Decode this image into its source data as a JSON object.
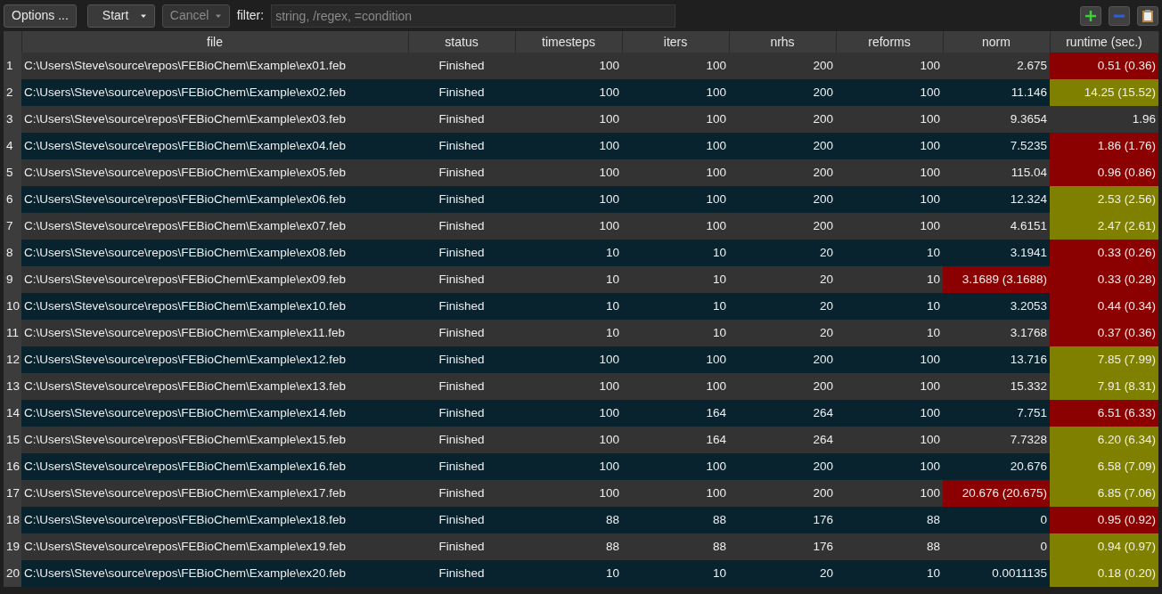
{
  "toolbar": {
    "options_button": "Options ...",
    "start_button": "Start",
    "cancel_button": {
      "label": "Cancel",
      "disabled": true
    },
    "filter_label": "filter:",
    "filter_placeholder": "string, /regex, =condition"
  },
  "table": {
    "columns": [
      "file",
      "status",
      "timesteps",
      "iters",
      "nrhs",
      "reforms",
      "norm",
      "runtime (sec.)"
    ],
    "rows": [
      {
        "number": "1",
        "cells": [
          {
            "text": "C:\\Users\\Steve\\source\\repos\\FEBioChem\\Example\\ex01.feb"
          },
          {
            "text": "Finished"
          },
          {
            "text": "100"
          },
          {
            "text": "100"
          },
          {
            "text": "200"
          },
          {
            "text": "100"
          },
          {
            "text": "2.675"
          },
          {
            "text": "0.51 (0.36)",
            "color": "#8b0000"
          }
        ]
      },
      {
        "number": "2",
        "cells": [
          {
            "text": "C:\\Users\\Steve\\source\\repos\\FEBioChem\\Example\\ex02.feb"
          },
          {
            "text": "Finished"
          },
          {
            "text": "100"
          },
          {
            "text": "100"
          },
          {
            "text": "200"
          },
          {
            "text": "100"
          },
          {
            "text": "11.146"
          },
          {
            "text": "14.25 (15.52)",
            "color": "#808000"
          }
        ]
      },
      {
        "number": "3",
        "cells": [
          {
            "text": "C:\\Users\\Steve\\source\\repos\\FEBioChem\\Example\\ex03.feb"
          },
          {
            "text": "Finished"
          },
          {
            "text": "100"
          },
          {
            "text": "100"
          },
          {
            "text": "200"
          },
          {
            "text": "100"
          },
          {
            "text": "9.3654"
          },
          {
            "text": "1.96"
          }
        ]
      },
      {
        "number": "4",
        "cells": [
          {
            "text": "C:\\Users\\Steve\\source\\repos\\FEBioChem\\Example\\ex04.feb"
          },
          {
            "text": "Finished"
          },
          {
            "text": "100"
          },
          {
            "text": "100"
          },
          {
            "text": "200"
          },
          {
            "text": "100"
          },
          {
            "text": "7.5235"
          },
          {
            "text": "1.86 (1.76)",
            "color": "#8b0000"
          }
        ]
      },
      {
        "number": "5",
        "cells": [
          {
            "text": "C:\\Users\\Steve\\source\\repos\\FEBioChem\\Example\\ex05.feb"
          },
          {
            "text": "Finished"
          },
          {
            "text": "100"
          },
          {
            "text": "100"
          },
          {
            "text": "200"
          },
          {
            "text": "100"
          },
          {
            "text": "115.04"
          },
          {
            "text": "0.96 (0.86)",
            "color": "#8b0000"
          }
        ]
      },
      {
        "number": "6",
        "cells": [
          {
            "text": "C:\\Users\\Steve\\source\\repos\\FEBioChem\\Example\\ex06.feb"
          },
          {
            "text": "Finished"
          },
          {
            "text": "100"
          },
          {
            "text": "100"
          },
          {
            "text": "200"
          },
          {
            "text": "100"
          },
          {
            "text": "12.324"
          },
          {
            "text": "2.53 (2.56)",
            "color": "#808000"
          }
        ]
      },
      {
        "number": "7",
        "cells": [
          {
            "text": "C:\\Users\\Steve\\source\\repos\\FEBioChem\\Example\\ex07.feb"
          },
          {
            "text": "Finished"
          },
          {
            "text": "100"
          },
          {
            "text": "100"
          },
          {
            "text": "200"
          },
          {
            "text": "100"
          },
          {
            "text": "4.6151"
          },
          {
            "text": "2.47 (2.61)",
            "color": "#808000"
          }
        ]
      },
      {
        "number": "8",
        "cells": [
          {
            "text": "C:\\Users\\Steve\\source\\repos\\FEBioChem\\Example\\ex08.feb"
          },
          {
            "text": "Finished"
          },
          {
            "text": "10"
          },
          {
            "text": "10"
          },
          {
            "text": "20"
          },
          {
            "text": "10"
          },
          {
            "text": "3.1941"
          },
          {
            "text": "0.33 (0.26)",
            "color": "#8b0000"
          }
        ]
      },
      {
        "number": "9",
        "cells": [
          {
            "text": "C:\\Users\\Steve\\source\\repos\\FEBioChem\\Example\\ex09.feb"
          },
          {
            "text": "Finished"
          },
          {
            "text": "10"
          },
          {
            "text": "10"
          },
          {
            "text": "20"
          },
          {
            "text": "10"
          },
          {
            "text": "3.1689 (3.1688)",
            "color": "#8b0000"
          },
          {
            "text": "0.33 (0.28)",
            "color": "#8b0000"
          }
        ]
      },
      {
        "number": "10",
        "cells": [
          {
            "text": "C:\\Users\\Steve\\source\\repos\\FEBioChem\\Example\\ex10.feb"
          },
          {
            "text": "Finished"
          },
          {
            "text": "10"
          },
          {
            "text": "10"
          },
          {
            "text": "20"
          },
          {
            "text": "10"
          },
          {
            "text": "3.2053"
          },
          {
            "text": "0.44 (0.34)",
            "color": "#8b0000"
          }
        ]
      },
      {
        "number": "11",
        "cells": [
          {
            "text": "C:\\Users\\Steve\\source\\repos\\FEBioChem\\Example\\ex11.feb"
          },
          {
            "text": "Finished"
          },
          {
            "text": "10"
          },
          {
            "text": "10"
          },
          {
            "text": "20"
          },
          {
            "text": "10"
          },
          {
            "text": "3.1768"
          },
          {
            "text": "0.37 (0.36)",
            "color": "#8b0000"
          }
        ]
      },
      {
        "number": "12",
        "cells": [
          {
            "text": "C:\\Users\\Steve\\source\\repos\\FEBioChem\\Example\\ex12.feb"
          },
          {
            "text": "Finished"
          },
          {
            "text": "100"
          },
          {
            "text": "100"
          },
          {
            "text": "200"
          },
          {
            "text": "100"
          },
          {
            "text": "13.716"
          },
          {
            "text": "7.85 (7.99)",
            "color": "#808000"
          }
        ]
      },
      {
        "number": "13",
        "cells": [
          {
            "text": "C:\\Users\\Steve\\source\\repos\\FEBioChem\\Example\\ex13.feb"
          },
          {
            "text": "Finished"
          },
          {
            "text": "100"
          },
          {
            "text": "100"
          },
          {
            "text": "200"
          },
          {
            "text": "100"
          },
          {
            "text": "15.332"
          },
          {
            "text": "7.91 (8.31)",
            "color": "#808000"
          }
        ]
      },
      {
        "number": "14",
        "cells": [
          {
            "text": "C:\\Users\\Steve\\source\\repos\\FEBioChem\\Example\\ex14.feb"
          },
          {
            "text": "Finished"
          },
          {
            "text": "100"
          },
          {
            "text": "164"
          },
          {
            "text": "264"
          },
          {
            "text": "100"
          },
          {
            "text": "7.751"
          },
          {
            "text": "6.51 (6.33)",
            "color": "#8b0000"
          }
        ]
      },
      {
        "number": "15",
        "cells": [
          {
            "text": "C:\\Users\\Steve\\source\\repos\\FEBioChem\\Example\\ex15.feb"
          },
          {
            "text": "Finished"
          },
          {
            "text": "100"
          },
          {
            "text": "164"
          },
          {
            "text": "264"
          },
          {
            "text": "100"
          },
          {
            "text": "7.7328"
          },
          {
            "text": "6.20 (6.34)",
            "color": "#808000"
          }
        ]
      },
      {
        "number": "16",
        "cells": [
          {
            "text": "C:\\Users\\Steve\\source\\repos\\FEBioChem\\Example\\ex16.feb"
          },
          {
            "text": "Finished"
          },
          {
            "text": "100"
          },
          {
            "text": "100"
          },
          {
            "text": "200"
          },
          {
            "text": "100"
          },
          {
            "text": "20.676"
          },
          {
            "text": "6.58 (7.09)",
            "color": "#808000"
          }
        ]
      },
      {
        "number": "17",
        "cells": [
          {
            "text": "C:\\Users\\Steve\\source\\repos\\FEBioChem\\Example\\ex17.feb"
          },
          {
            "text": "Finished"
          },
          {
            "text": "100"
          },
          {
            "text": "100"
          },
          {
            "text": "200"
          },
          {
            "text": "100"
          },
          {
            "text": "20.676 (20.675)",
            "color": "#8b0000"
          },
          {
            "text": "6.85 (7.06)",
            "color": "#808000"
          }
        ]
      },
      {
        "number": "18",
        "cells": [
          {
            "text": "C:\\Users\\Steve\\source\\repos\\FEBioChem\\Example\\ex18.feb"
          },
          {
            "text": "Finished"
          },
          {
            "text": "88"
          },
          {
            "text": "88"
          },
          {
            "text": "176"
          },
          {
            "text": "88"
          },
          {
            "text": "0"
          },
          {
            "text": "0.95 (0.92)",
            "color": "#8b0000"
          }
        ]
      },
      {
        "number": "19",
        "cells": [
          {
            "text": "C:\\Users\\Steve\\source\\repos\\FEBioChem\\Example\\ex19.feb"
          },
          {
            "text": "Finished"
          },
          {
            "text": "88"
          },
          {
            "text": "88"
          },
          {
            "text": "176"
          },
          {
            "text": "88"
          },
          {
            "text": "0"
          },
          {
            "text": "0.94 (0.97)",
            "color": "#808000"
          }
        ]
      },
      {
        "number": "20",
        "cells": [
          {
            "text": "C:\\Users\\Steve\\source\\repos\\FEBioChem\\Example\\ex20.feb"
          },
          {
            "text": "Finished"
          },
          {
            "text": "10"
          },
          {
            "text": "10"
          },
          {
            "text": "20"
          },
          {
            "text": "10"
          },
          {
            "text": "0.0011135"
          },
          {
            "text": "0.18 (0.20)",
            "color": "#808000"
          }
        ]
      }
    ]
  }
}
